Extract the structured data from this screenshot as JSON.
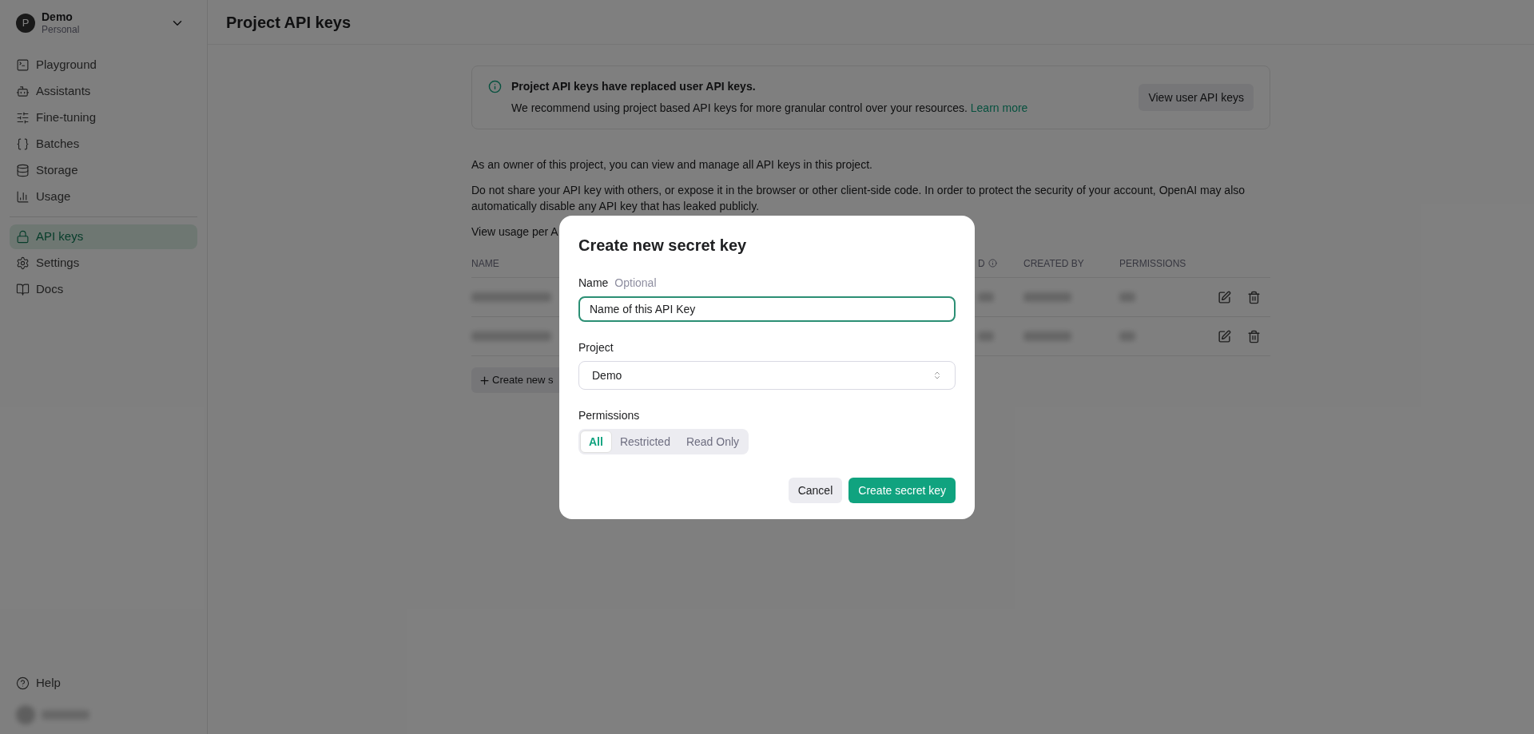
{
  "sidebar": {
    "account": {
      "avatar_letter": "P",
      "name": "Demo",
      "subtitle": "Personal"
    },
    "nav_groups": [
      [
        {
          "label": "Playground",
          "selected": false
        },
        {
          "label": "Assistants",
          "selected": false
        },
        {
          "label": "Fine-tuning",
          "selected": false
        },
        {
          "label": "Batches",
          "selected": false
        },
        {
          "label": "Storage",
          "selected": false
        },
        {
          "label": "Usage",
          "selected": false
        }
      ],
      [
        {
          "label": "API keys",
          "selected": true
        },
        {
          "label": "Settings",
          "selected": false
        },
        {
          "label": "Docs",
          "selected": false
        }
      ]
    ],
    "footer": [
      {
        "label": "Help",
        "selected": false
      }
    ]
  },
  "header": {
    "title": "Project API keys"
  },
  "notice": {
    "title": "Project API keys have replaced user API keys.",
    "text": "We recommend using project based API keys for more granular control over your resources.",
    "link": "Learn more",
    "button": "View user API keys"
  },
  "paragraphs": [
    "As an owner of this project, you can view and manage all API keys in this project.",
    "Do not share your API key with others, or expose it in the browser or other client-side code. In order to protect the security of your account, OpenAI may also automatically disable any API key that has leaked publicly."
  ],
  "usage_text": "View usage per A",
  "table": {
    "columns": [
      "NAME",
      "D",
      "CREATED BY",
      "PERMISSIONS"
    ],
    "rows": [
      {
        "kind": "redacted"
      },
      {
        "kind": "redacted"
      }
    ]
  },
  "create_button": "Create new s",
  "dialog": {
    "title": "Create new secret key",
    "name_label": "Name",
    "name_hint": "Optional",
    "name_value": "Name of this API Key",
    "project_label": "Project",
    "project_value": "Demo",
    "permissions_label": "Permissions",
    "permissions": [
      {
        "label": "All",
        "selected": true
      },
      {
        "label": "Restricted",
        "selected": false
      },
      {
        "label": "Read Only",
        "selected": false
      }
    ],
    "cancel": "Cancel",
    "submit": "Create secret key"
  }
}
